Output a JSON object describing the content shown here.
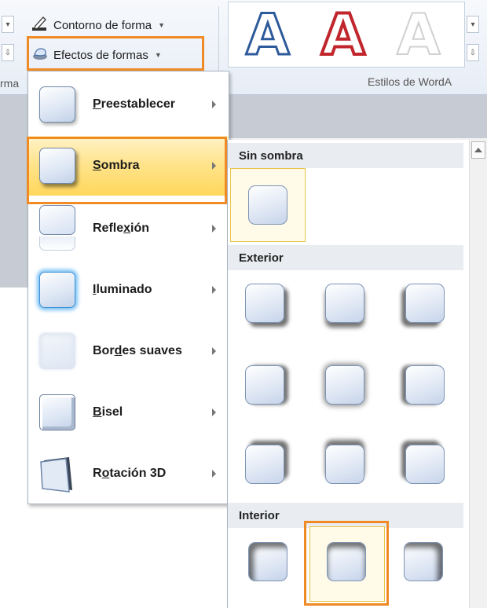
{
  "ribbon": {
    "shape_outline_label": "Contorno de forma",
    "shape_effects_label": "Efectos de formas",
    "wordart_styles_label": "Estilos de WordA",
    "format_partial_label": "rma",
    "wordart_letter": "A",
    "wordart_colors": [
      "#2d5a9a",
      "#c0262c",
      "#d9d9d9"
    ]
  },
  "menu": {
    "items": [
      {
        "label": "Preestablecer",
        "accel": "P",
        "rest": "reestablecer"
      },
      {
        "label": "Sombra",
        "accel": "S",
        "rest": "ombra"
      },
      {
        "label": "Reflexión",
        "pre": "Refle",
        "accel": "x",
        "rest": "ión"
      },
      {
        "label": "Iluminado",
        "accel": "I",
        "rest": "luminado"
      },
      {
        "label": "Bordes suaves",
        "pre": "Bor",
        "accel": "d",
        "rest": "es suaves"
      },
      {
        "label": "Bisel",
        "accel": "B",
        "rest": "isel"
      },
      {
        "label": "Rotación 3D",
        "pre": "R",
        "accel": "o",
        "rest": "tación 3D"
      }
    ]
  },
  "submenu": {
    "sections": [
      {
        "title": "Sin sombra"
      },
      {
        "title": "Exterior"
      },
      {
        "title": "Interior"
      }
    ]
  },
  "colors": {
    "highlight": "#f08a24",
    "active_menu": "#ffdf7a"
  }
}
